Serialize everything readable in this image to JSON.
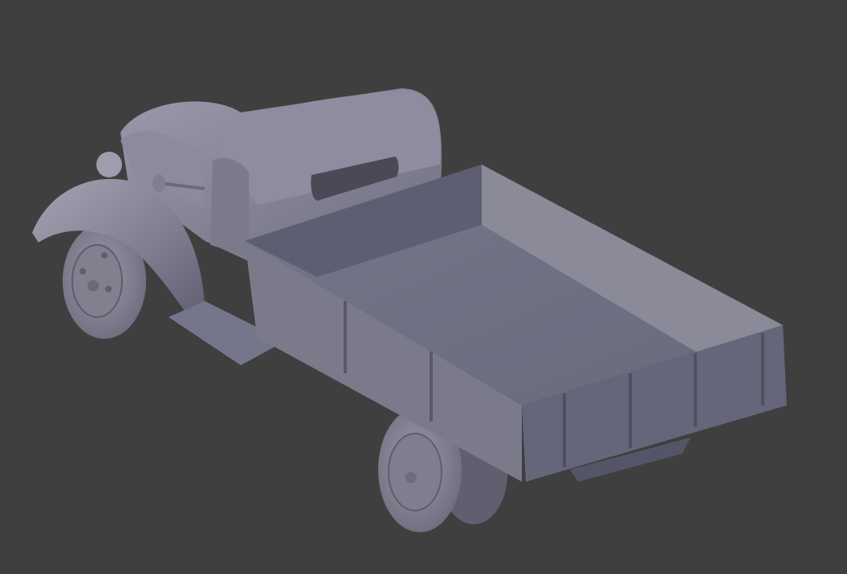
{
  "viewport": {
    "background_color": "#3f3f3f",
    "model_color": "#8a8a99"
  },
  "model": {
    "object_names": [
      "cab",
      "bed",
      "front-fender",
      "front-wheel",
      "rear-wheel",
      "mirror",
      "headlight"
    ]
  }
}
